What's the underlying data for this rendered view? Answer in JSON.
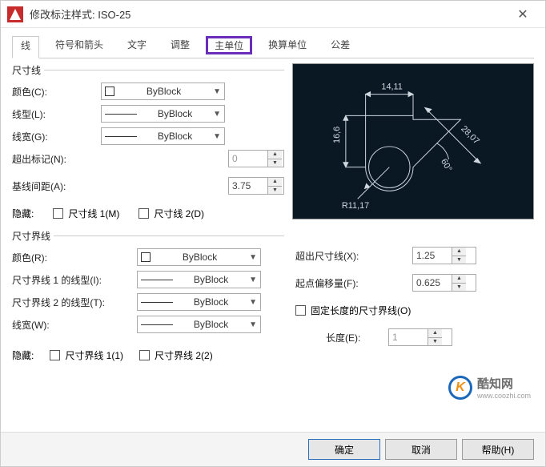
{
  "title": "修改标注样式: ISO-25",
  "tabs": [
    "线",
    "符号和箭头",
    "文字",
    "调整",
    "主单位",
    "换算单位",
    "公差"
  ],
  "group1": {
    "legend": "尺寸线",
    "color_lbl": "颜色(C):",
    "color_val": "ByBlock",
    "linetype_lbl": "线型(L):",
    "linetype_val": "ByBlock",
    "lineweight_lbl": "线宽(G):",
    "lineweight_val": "ByBlock",
    "extend_lbl": "超出标记(N):",
    "extend_val": "0",
    "baseline_lbl": "基线间距(A):",
    "baseline_val": "3.75",
    "hide_lbl": "隐藏:",
    "hide1": "尺寸线 1(M)",
    "hide2": "尺寸线 2(D)"
  },
  "group2": {
    "legend": "尺寸界线",
    "color_lbl": "颜色(R):",
    "color_val": "ByBlock",
    "lt1_lbl": "尺寸界线 1 的线型(I):",
    "lt1_val": "ByBlock",
    "lt2_lbl": "尺寸界线 2 的线型(T):",
    "lt2_val": "ByBlock",
    "lw_lbl": "线宽(W):",
    "lw_val": "ByBlock",
    "hide_lbl": "隐藏:",
    "hide1": "尺寸界线 1(1)",
    "hide2": "尺寸界线 2(2)"
  },
  "right": {
    "extend_lbl": "超出尺寸线(X):",
    "extend_val": "1.25",
    "offset_lbl": "起点偏移量(F):",
    "offset_val": "0.625",
    "fixed_lbl": "固定长度的尺寸界线(O)",
    "len_lbl": "长度(E):",
    "len_val": "1"
  },
  "preview": {
    "d_top": "14,11",
    "d_left": "16,6",
    "d_diag": "28,07",
    "d_radius": "R11,17",
    "d_angle": "60°"
  },
  "footer": {
    "ok": "确定",
    "cancel": "取消",
    "help": "帮助(H)"
  },
  "watermark": {
    "glyph": "K",
    "text": "酷知网",
    "url": "www.coozhi.com"
  }
}
